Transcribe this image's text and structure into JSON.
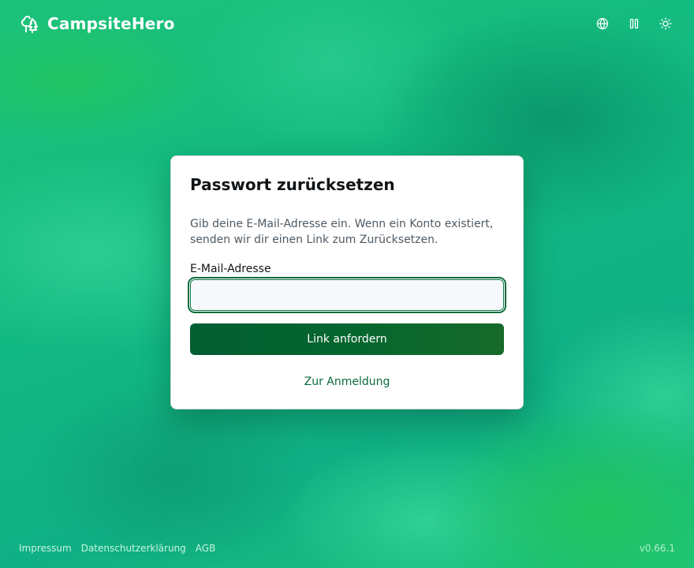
{
  "brand": {
    "name": "CampsiteHero",
    "icon": "trees-icon",
    "color": "#ffffff"
  },
  "header_actions": [
    {
      "icon": "globe-icon",
      "label": "language"
    },
    {
      "icon": "pause-icon",
      "label": "pause"
    },
    {
      "icon": "sun-icon",
      "label": "theme"
    }
  ],
  "card": {
    "title": "Passwort zurücksetzen",
    "description": "Gib deine E-Mail-Adresse ein. Wenn ein Konto existiert, senden wir dir einen Link zum Zurücksetzen.",
    "email_label": "E-Mail-Adresse",
    "email_value": "",
    "email_placeholder": "",
    "submit_label": "Link anfordern",
    "back_link": "Zur Anmeldung"
  },
  "footer": {
    "links": [
      "Impressum",
      "Datenschutzerklärung",
      "AGB"
    ],
    "version": "v0.66.1"
  },
  "colors": {
    "accent": "#0a6a3c",
    "button": "#035e32",
    "background": "#12b981"
  }
}
